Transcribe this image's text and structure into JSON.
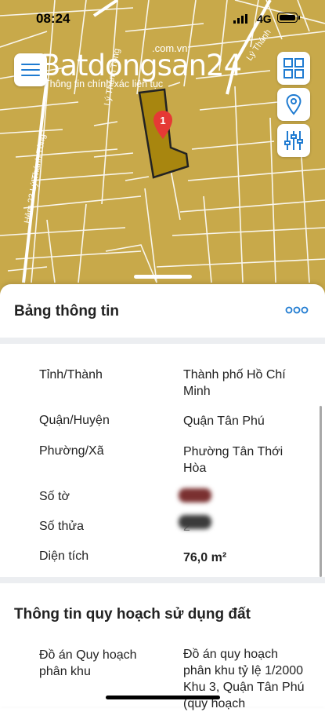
{
  "status_bar": {
    "time": "08:24",
    "network": "4G"
  },
  "logo": {
    "domain": ".com.vn",
    "brand": "Batdongsan24",
    "tagline": "Thông tin chính xác liên tục"
  },
  "map": {
    "plot_number": "1",
    "street_labels": [
      "Hẻm 23 Lý Thánh Tông",
      "Lý Thánh Tông",
      "Lý Thánh"
    ]
  },
  "colors": {
    "map_bg": "#c8a94a",
    "plot_fill": "#a8860f",
    "accent": "#1f7bd1",
    "pin": "#e53935"
  },
  "icons": [
    "menu-icon",
    "grid-icon",
    "location-pin-icon",
    "sliders-icon",
    "more-icon"
  ],
  "sheet": {
    "title": "Bảng thông tin",
    "rows": [
      {
        "label": "Tỉnh/Thành",
        "value": "Thành phố Hồ Chí Minh"
      },
      {
        "label": "Quận/Huyện",
        "value": "Quận Tân Phú"
      },
      {
        "label": "Phường/Xã",
        "value": "Phường Tân Thới Hòa"
      },
      {
        "label": "Số tờ",
        "value": ""
      },
      {
        "label": "Số thửa",
        "value": "2"
      },
      {
        "label": "Diện tích",
        "value": "76,0 m²"
      }
    ],
    "planning_title": "Thông tin quy hoạch sử dụng đất",
    "planning_rows": [
      {
        "label": "Đồ án Quy hoạch phân khu",
        "value": "Đồ án quy hoạch phân khu tỷ lệ 1/2000 Khu 3, Quận Tân Phú (quy hoạch"
      }
    ]
  }
}
